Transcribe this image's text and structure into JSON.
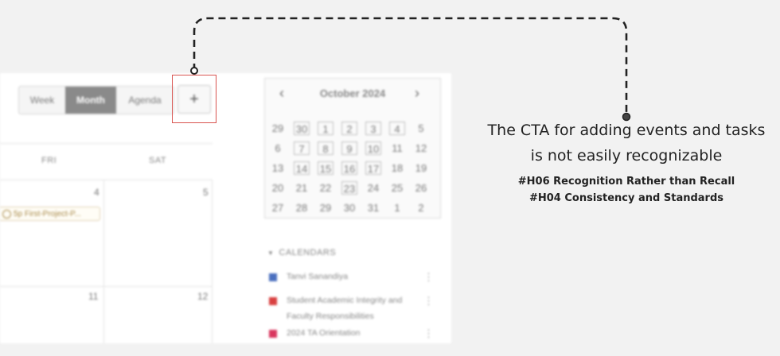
{
  "toolbar": {
    "views": [
      "Week",
      "Month",
      "Agenda"
    ],
    "active_view": "Month",
    "add_button": "+"
  },
  "week_headers": [
    "FRI",
    "SAT"
  ],
  "dates": {
    "row1": [
      "4",
      "5"
    ],
    "row2": [
      "11",
      "12"
    ]
  },
  "event": {
    "label": "5p First-Project-P..."
  },
  "mini_calendar": {
    "title": "October 2024",
    "prev": "‹",
    "next": "›",
    "weeks": [
      [
        "29",
        "30",
        "1",
        "2",
        "3",
        "4",
        "5"
      ],
      [
        "6",
        "7",
        "8",
        "9",
        "10",
        "11",
        "12"
      ],
      [
        "13",
        "14",
        "15",
        "16",
        "17",
        "18",
        "19"
      ],
      [
        "20",
        "21",
        "22",
        "23",
        "24",
        "25",
        "26"
      ],
      [
        "27",
        "28",
        "29",
        "30",
        "31",
        "1",
        "2"
      ]
    ]
  },
  "calendars": {
    "header": "CALENDARS",
    "items": [
      {
        "label": "Tanvi Sanandiya",
        "color": "#4a6fbf"
      },
      {
        "label": "Student Academic Integrity and Faculty Responsibilities",
        "color": "#d94040"
      },
      {
        "label": "2024 TA Orientation",
        "color": "#d9365e"
      }
    ]
  },
  "annotation": {
    "line1": "The CTA for adding events and tasks",
    "line2": "is not easily recognizable",
    "tag1": "#H06 Recognition Rather than Recall",
    "tag2": "#H04 Consistency and Standards"
  }
}
